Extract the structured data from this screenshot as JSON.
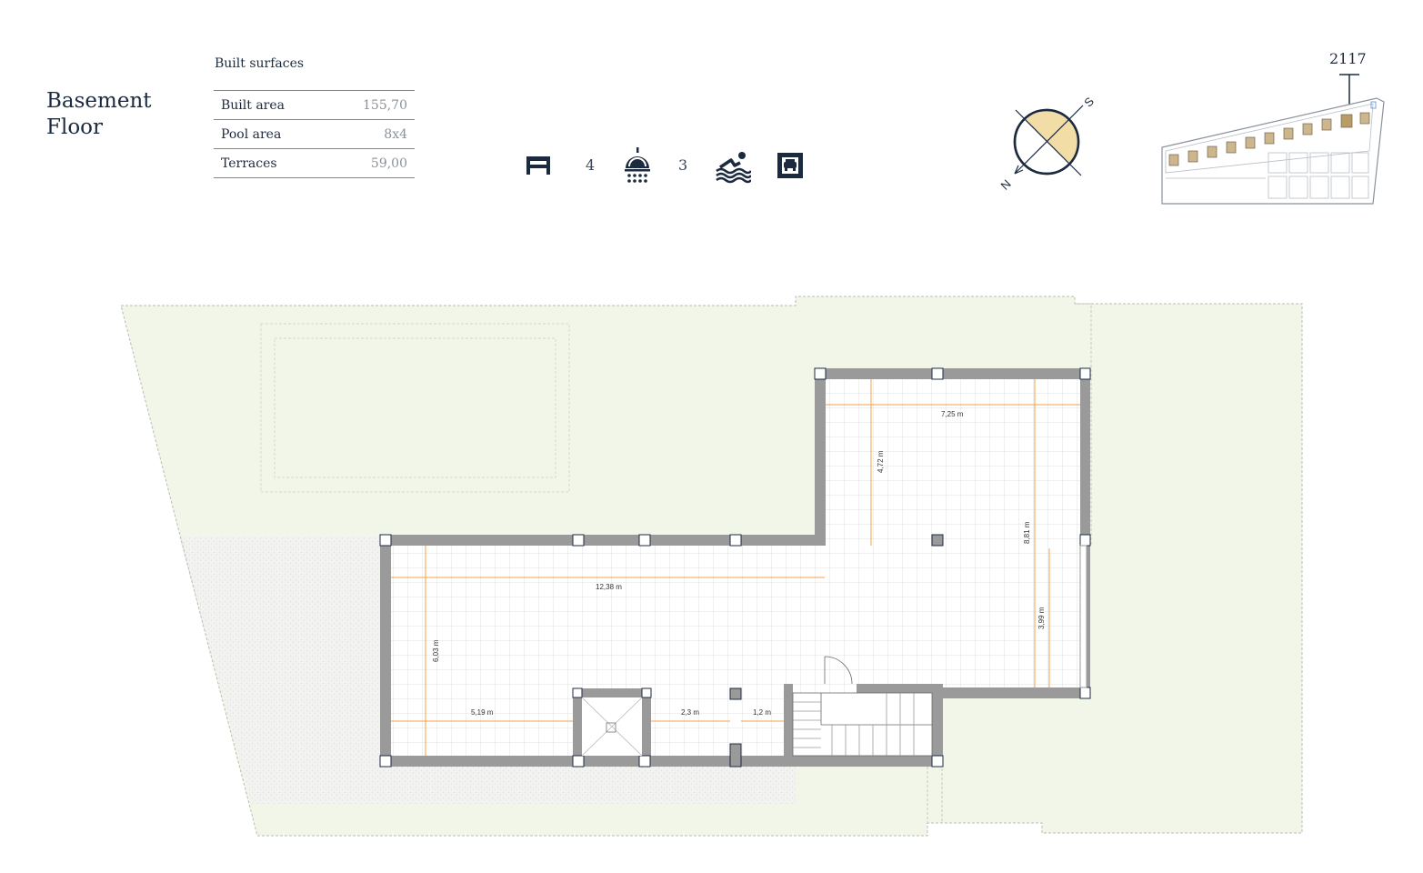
{
  "title": "Basement\nFloor",
  "title_line1": "Basement",
  "title_line2": "Floor",
  "surfaces": {
    "heading": "Built surfaces",
    "rows": [
      {
        "label": "Built area",
        "value": "155,70"
      },
      {
        "label": "Pool area",
        "value": "8x4"
      },
      {
        "label": "Terraces",
        "value": "59,00"
      }
    ]
  },
  "amenities": {
    "bedrooms": {
      "icon": "bed-icon",
      "count": "4"
    },
    "bathrooms": {
      "icon": "shower-icon",
      "count": "3"
    },
    "pool": {
      "icon": "pool-icon"
    },
    "garage": {
      "icon": "garage-icon"
    }
  },
  "compass": {
    "north": "N",
    "south": "S",
    "highlight_color": "#f2dda6"
  },
  "site_plan": {
    "plot_number": "2117",
    "highlight_color": "#cdb68c"
  },
  "dimensions": {
    "d1": "7,25 m",
    "d2": "4,72 m",
    "d3": "8,81 m",
    "d4": "12,38 m",
    "d5": "3,99 m",
    "d6": "6,03 m",
    "d7": "5,19 m",
    "d8": "2,3 m",
    "d9": "1,2 m"
  },
  "colors": {
    "garden": "#f1f6e8",
    "wall": "#9a9a9a",
    "dimension_line": "#f0a24a",
    "navy": "#1c2a40"
  }
}
